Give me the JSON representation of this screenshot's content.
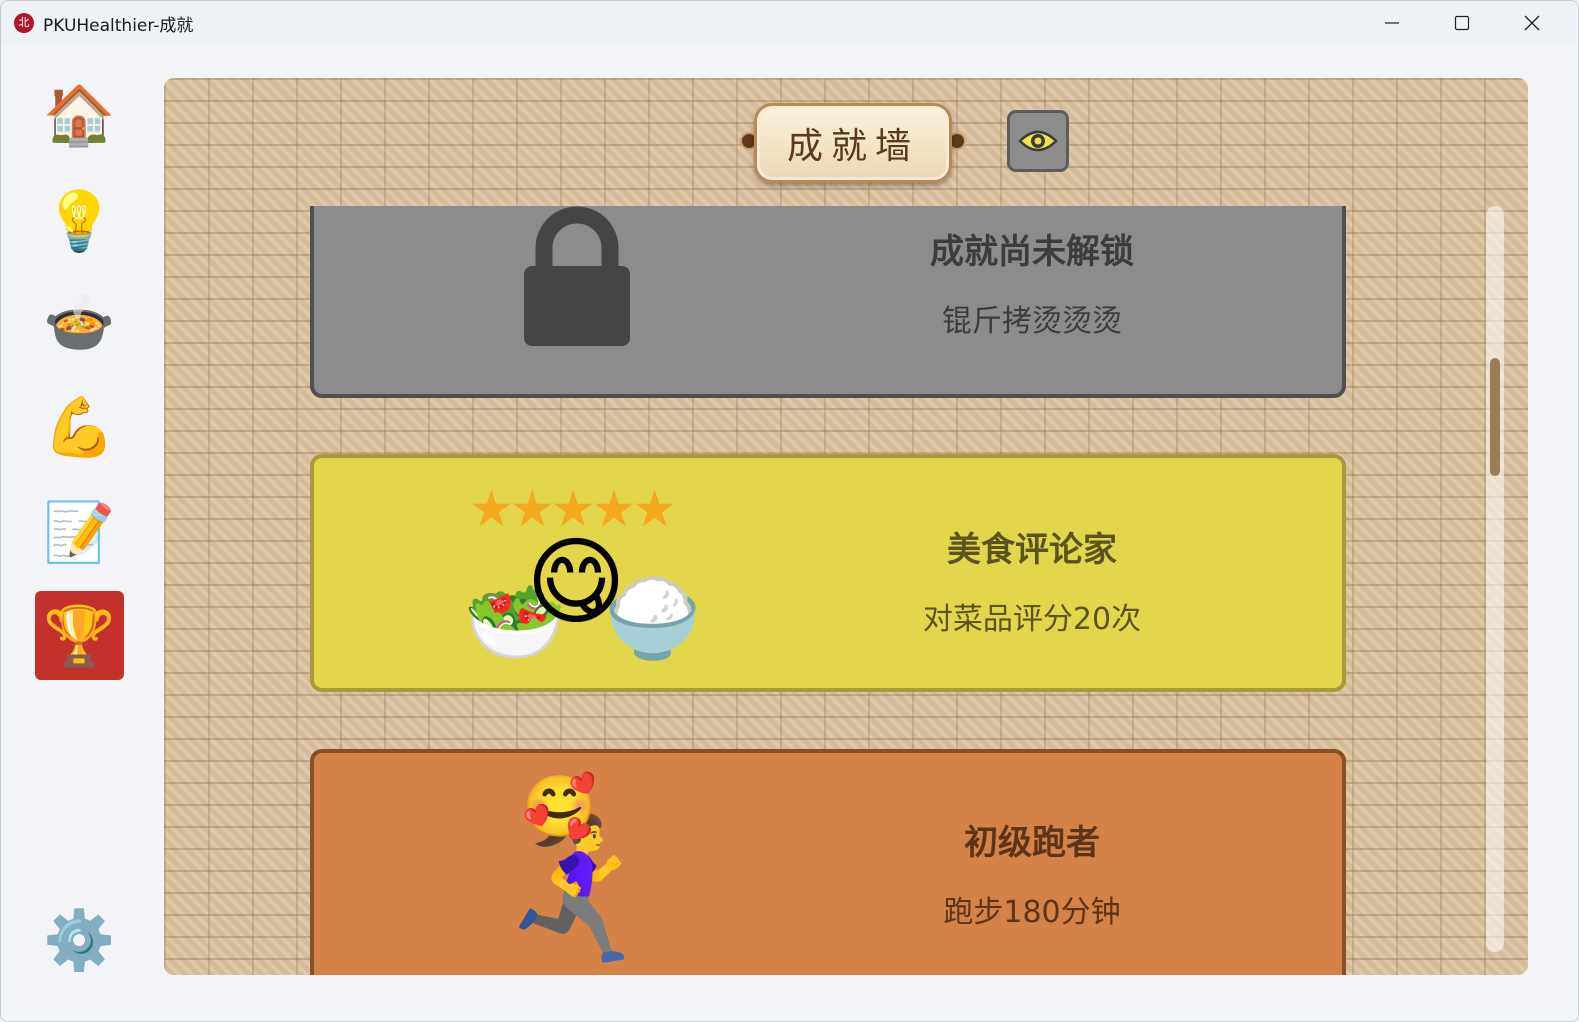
{
  "window": {
    "title": "PKUHealthier-成就",
    "app_icon_label": "北",
    "controls": [
      "minimize",
      "maximize",
      "close"
    ]
  },
  "sidebar": {
    "items": [
      {
        "name": "home",
        "icon": "🏠",
        "active": false
      },
      {
        "name": "tips",
        "icon": "💡",
        "active": false
      },
      {
        "name": "food",
        "icon": "🍲",
        "active": false
      },
      {
        "name": "exercise",
        "icon": "💪",
        "active": false
      },
      {
        "name": "notes",
        "icon": "📝",
        "active": false
      },
      {
        "name": "achievements",
        "icon": "🏆",
        "active": true
      }
    ],
    "settings_icon": "⚙️"
  },
  "header": {
    "title": "成就墙",
    "eye_button": "eye-icon"
  },
  "achievements": [
    {
      "title": "成就尚未解锁",
      "description": "锟斤拷烫烫烫",
      "locked": true,
      "color": "#8c8c8c"
    },
    {
      "title": "美食评论家",
      "description": "对菜品评分20次",
      "locked": false,
      "color": "#e2d64a",
      "stars": "★★★★★",
      "art": [
        "🥗",
        "😋",
        "🍚"
      ]
    },
    {
      "title": "初级跑者",
      "description": "跑步180分钟",
      "locked": false,
      "color": "#d48248",
      "art": [
        "🏃‍♀️",
        "🥰"
      ]
    }
  ]
}
